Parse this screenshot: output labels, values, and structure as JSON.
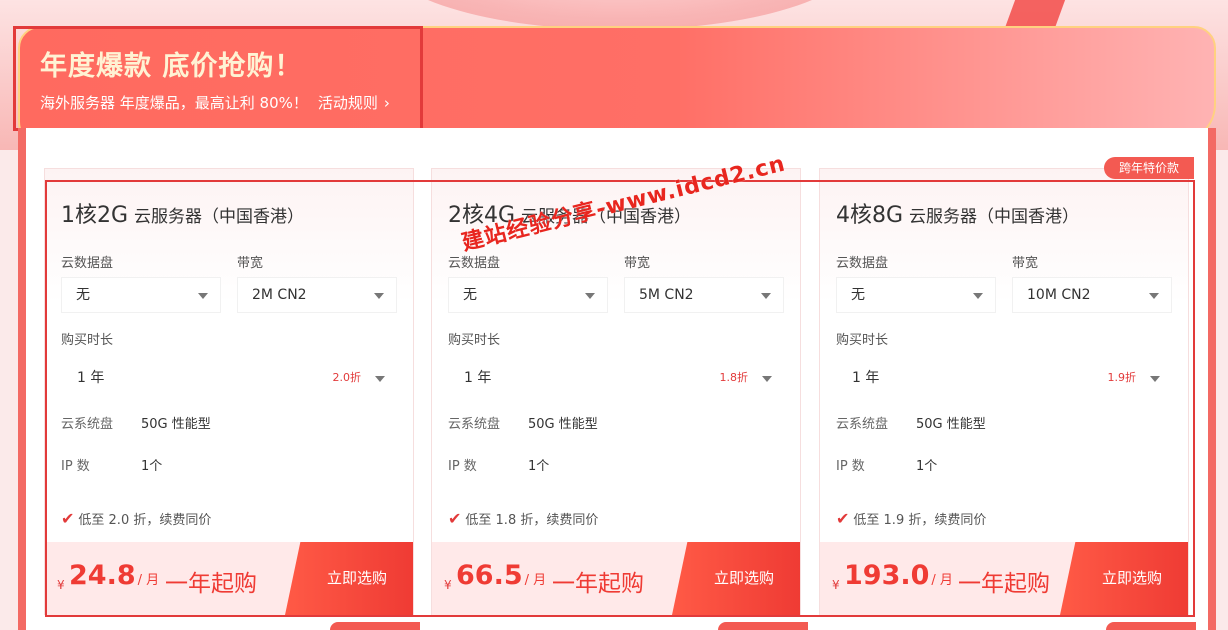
{
  "banner": {
    "title": "年度爆款 底价抢购！",
    "subtitle": "海外服务器 年度爆品，最高让利 80%！",
    "rules_label": "活动规则",
    "chevron": "chevron-right-icon"
  },
  "badge_label": "跨年特价款",
  "watermark": "建站经验分享-www.idcd2.cn",
  "labels": {
    "data_disk": "云数据盘",
    "bandwidth": "带宽",
    "duration": "购买时长",
    "system_disk": "云系统盘",
    "ip_count": "IP 数"
  },
  "cards": [
    {
      "spec": "1核2G",
      "name": "云服务器（中国香港）",
      "data_disk": "无",
      "bandwidth": "2M CN2",
      "duration": "1 年",
      "discount": "2.0折",
      "system_disk": "50G 性能型",
      "ip_count": "1个",
      "note": "低至 2.0 折，续费同价",
      "currency": "¥",
      "price": "24.8",
      "unit": "/ 月",
      "period": "一年起购",
      "buy_label": "立即选购"
    },
    {
      "spec": "2核4G",
      "name": "云服务器（中国香港）",
      "data_disk": "无",
      "bandwidth": "5M CN2",
      "duration": "1 年",
      "discount": "1.8折",
      "system_disk": "50G 性能型",
      "ip_count": "1个",
      "note": "低至 1.8 折，续费同价",
      "currency": "¥",
      "price": "66.5",
      "unit": "/ 月",
      "period": "一年起购",
      "buy_label": "立即选购"
    },
    {
      "spec": "4核8G",
      "name": "云服务器（中国香港）",
      "data_disk": "无",
      "bandwidth": "10M CN2",
      "duration": "1 年",
      "discount": "1.9折",
      "system_disk": "50G 性能型",
      "ip_count": "1个",
      "note": "低至 1.9 折，续费同价",
      "currency": "¥",
      "price": "193.0",
      "unit": "/ 月",
      "period": "一年起购",
      "buy_label": "立即选购"
    }
  ],
  "colors": {
    "accent": "#ef3b34",
    "banner": "#ff6a5f",
    "highlight_box": "#e23a3a"
  }
}
